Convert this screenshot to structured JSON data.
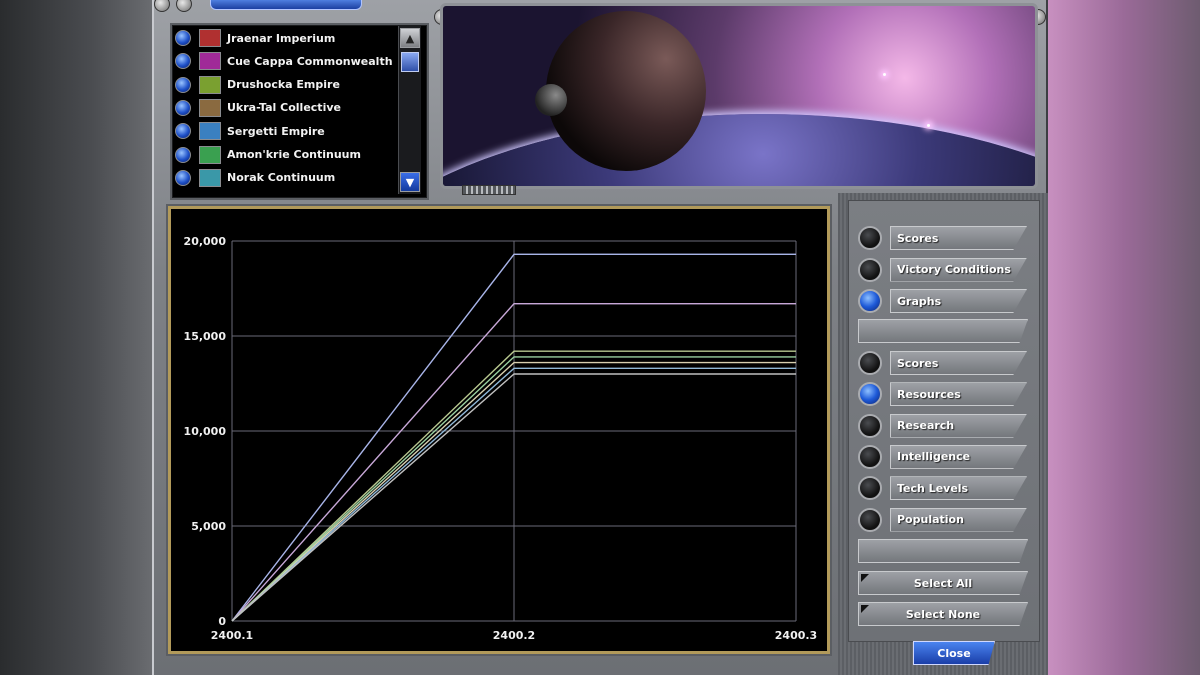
{
  "empires": [
    {
      "name": "Jraenar Imperium",
      "emblem_color": "#b03030",
      "selected": true
    },
    {
      "name": "Cue Cappa Commonwealth",
      "emblem_color": "#a02a98",
      "selected": true
    },
    {
      "name": "Drushocka Empire",
      "emblem_color": "#7aa030",
      "selected": true
    },
    {
      "name": "Ukra-Tal Collective",
      "emblem_color": "#8a6a40",
      "selected": true
    },
    {
      "name": "Sergetti Empire",
      "emblem_color": "#3a80c0",
      "selected": true
    },
    {
      "name": "Amon'krie Continuum",
      "emblem_color": "#3aa050",
      "selected": true
    },
    {
      "name": "Norak Continuum",
      "emblem_color": "#3a98a8",
      "selected": true
    }
  ],
  "view_options": [
    {
      "label": "Scores",
      "selected": false
    },
    {
      "label": "Victory Conditions",
      "selected": false
    },
    {
      "label": "Graphs",
      "selected": true
    }
  ],
  "graph_options": [
    {
      "label": "Scores",
      "selected": false
    },
    {
      "label": "Resources",
      "selected": true
    },
    {
      "label": "Research",
      "selected": false
    },
    {
      "label": "Intelligence",
      "selected": false
    },
    {
      "label": "Tech Levels",
      "selected": false
    },
    {
      "label": "Population",
      "selected": false
    }
  ],
  "buttons": {
    "select_all": "Select All",
    "select_none": "Select None",
    "close": "Close"
  },
  "chart_data": {
    "type": "line",
    "x": [
      "2400.1",
      "2400.2",
      "2400.3"
    ],
    "ylim": [
      0,
      20000
    ],
    "yticks": [
      "0",
      "5,000",
      "10,000",
      "15,000",
      "20,000"
    ],
    "grid": true,
    "series": [
      {
        "color": "#a8b4e8",
        "values": [
          0,
          19300,
          19300
        ]
      },
      {
        "color": "#c8a8d8",
        "values": [
          0,
          16700,
          16700
        ]
      },
      {
        "color": "#b8c890",
        "values": [
          0,
          14200,
          14200
        ]
      },
      {
        "color": "#9ad0a0",
        "values": [
          0,
          13900,
          13900
        ]
      },
      {
        "color": "#d8d0b0",
        "values": [
          0,
          13600,
          13600
        ]
      },
      {
        "color": "#90b8d8",
        "values": [
          0,
          13300,
          13300
        ]
      },
      {
        "color": "#c0c0c0",
        "values": [
          0,
          13000,
          13000
        ]
      }
    ]
  }
}
